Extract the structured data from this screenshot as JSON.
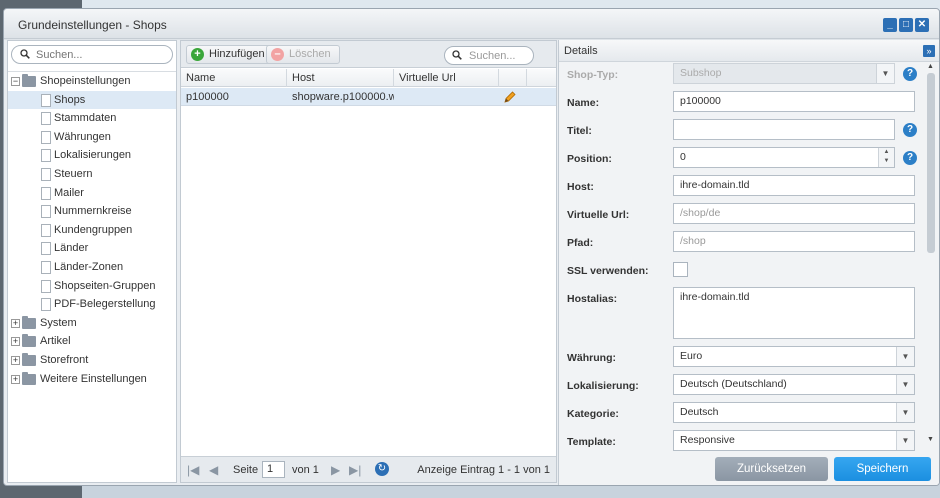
{
  "window": {
    "title": "Grundeinstellungen - Shops"
  },
  "tree": {
    "search_placeholder": "Suchen...",
    "nodes": [
      {
        "label": "Shopeinstellungen",
        "type": "folder",
        "expanded": true,
        "level": 0
      },
      {
        "label": "Shops",
        "type": "leaf",
        "level": 1,
        "selected": true
      },
      {
        "label": "Stammdaten",
        "type": "leaf",
        "level": 1
      },
      {
        "label": "Währungen",
        "type": "leaf",
        "level": 1
      },
      {
        "label": "Lokalisierungen",
        "type": "leaf",
        "level": 1
      },
      {
        "label": "Steuern",
        "type": "leaf",
        "level": 1
      },
      {
        "label": "Mailer",
        "type": "leaf",
        "level": 1
      },
      {
        "label": "Nummernkreise",
        "type": "leaf",
        "level": 1
      },
      {
        "label": "Kundengruppen",
        "type": "leaf",
        "level": 1
      },
      {
        "label": "Länder",
        "type": "leaf",
        "level": 1
      },
      {
        "label": "Länder-Zonen",
        "type": "leaf",
        "level": 1
      },
      {
        "label": "Shopseiten-Gruppen",
        "type": "leaf",
        "level": 1
      },
      {
        "label": "PDF-Belegerstellung",
        "type": "leaf",
        "level": 1
      },
      {
        "label": "System",
        "type": "folder",
        "expanded": false,
        "level": 0
      },
      {
        "label": "Artikel",
        "type": "folder",
        "expanded": false,
        "level": 0
      },
      {
        "label": "Storefront",
        "type": "folder",
        "expanded": false,
        "level": 0
      },
      {
        "label": "Weitere Einstellungen",
        "type": "folder",
        "expanded": false,
        "level": 0
      }
    ]
  },
  "grid": {
    "add_label": "Hinzufügen",
    "delete_label": "Löschen",
    "search_placeholder": "Suchen...",
    "columns": [
      "Name",
      "Host",
      "Virtuelle Url"
    ],
    "rows": [
      {
        "name": "p100000",
        "host": "shopware.p100000.w...",
        "virtual_url": ""
      }
    ],
    "pager": {
      "page_label": "Seite",
      "page": "1",
      "of_label": "von 1",
      "info": "Anzeige Eintrag 1 - 1 von 1"
    }
  },
  "details": {
    "title": "Details",
    "fields": {
      "shop_type": {
        "label": "Shop-Typ:",
        "value": "Subshop"
      },
      "name": {
        "label": "Name:",
        "value": "p100000"
      },
      "title": {
        "label": "Titel:",
        "value": ""
      },
      "position": {
        "label": "Position:",
        "value": "0"
      },
      "host": {
        "label": "Host:",
        "value": "ihre-domain.tld"
      },
      "virtual_url": {
        "label": "Virtuelle Url:",
        "placeholder": "/shop/de"
      },
      "path": {
        "label": "Pfad:",
        "placeholder": "/shop"
      },
      "ssl": {
        "label": "SSL verwenden:"
      },
      "hostalias": {
        "label": "Hostalias:",
        "value": "ihre-domain.tld"
      },
      "currency": {
        "label": "Währung:",
        "value": "Euro"
      },
      "locale": {
        "label": "Lokalisierung:",
        "value": "Deutsch (Deutschland)"
      },
      "category": {
        "label": "Kategorie:",
        "value": "Deutsch"
      },
      "template": {
        "label": "Template:",
        "value": "Responsive"
      }
    },
    "reset_label": "Zurücksetzen",
    "save_label": "Speichern"
  },
  "colors": {
    "accent": "#2c7fc7",
    "save": "#1b8fe0",
    "reset": "#8c98a5"
  }
}
